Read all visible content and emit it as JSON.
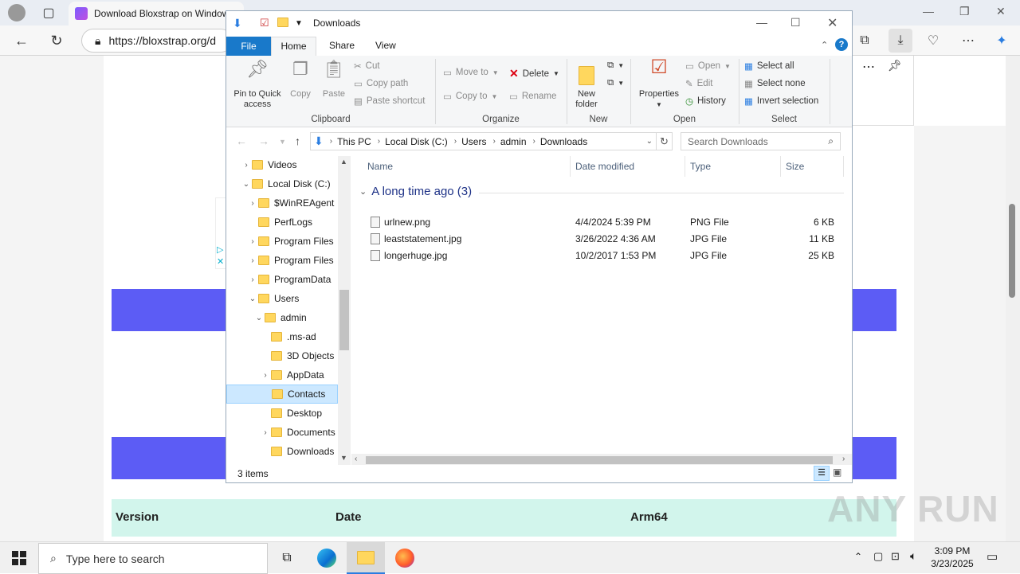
{
  "browser": {
    "tab_title": "Download Bloxstrap on Windows",
    "url": "https://bloxstrap.org/d",
    "back_icon": "arrow-left-icon",
    "reload_icon": "reload-icon"
  },
  "webpage": {
    "version_header": "Version",
    "date_header": "Date",
    "arch_header": "Arm64",
    "ad_play_icon": "▷",
    "ad_close_icon": "✕",
    "accent_color": "#5c5cf5"
  },
  "explorer": {
    "title": "Downloads",
    "ribbon_tabs": [
      "File",
      "Home",
      "Share",
      "View"
    ],
    "clipboard": {
      "pin": "Pin to Quick access",
      "copy": "Copy",
      "paste": "Paste",
      "cut": "Cut",
      "copy_path": "Copy path",
      "paste_shortcut": "Paste shortcut",
      "group": "Clipboard"
    },
    "organize": {
      "move_to": "Move to",
      "copy_to": "Copy to",
      "delete": "Delete",
      "rename": "Rename",
      "group": "Organize"
    },
    "new": {
      "new_folder": "New folder",
      "group": "New"
    },
    "open": {
      "properties": "Properties",
      "open": "Open",
      "edit": "Edit",
      "history": "History",
      "group": "Open"
    },
    "select": {
      "select_all": "Select all",
      "select_none": "Select none",
      "invert": "Invert selection",
      "group": "Select"
    },
    "address": {
      "crumbs": [
        "This PC",
        "Local Disk (C:)",
        "Users",
        "admin",
        "Downloads"
      ]
    },
    "search_placeholder": "Search Downloads",
    "tree": [
      {
        "label": "Videos",
        "indent": 0,
        "exp": "›"
      },
      {
        "label": "Local Disk (C:)",
        "indent": 0,
        "exp": "⌄"
      },
      {
        "label": "$WinREAgent",
        "indent": 1,
        "exp": "›"
      },
      {
        "label": "PerfLogs",
        "indent": 1,
        "exp": ""
      },
      {
        "label": "Program Files",
        "indent": 1,
        "exp": "›"
      },
      {
        "label": "Program Files",
        "indent": 1,
        "exp": "›"
      },
      {
        "label": "ProgramData",
        "indent": 1,
        "exp": "›"
      },
      {
        "label": "Users",
        "indent": 1,
        "exp": "⌄"
      },
      {
        "label": "admin",
        "indent": 2,
        "exp": "⌄"
      },
      {
        "label": ".ms-ad",
        "indent": 3,
        "exp": ""
      },
      {
        "label": "3D Objects",
        "indent": 3,
        "exp": ""
      },
      {
        "label": "AppData",
        "indent": 3,
        "exp": "›"
      },
      {
        "label": "Contacts",
        "indent": 3,
        "exp": ""
      },
      {
        "label": "Desktop",
        "indent": 3,
        "exp": ""
      },
      {
        "label": "Documents",
        "indent": 3,
        "exp": "›"
      },
      {
        "label": "Downloads",
        "indent": 3,
        "exp": ""
      }
    ],
    "columns": [
      "Name",
      "Date modified",
      "Type",
      "Size"
    ],
    "group_header": "A long time ago (3)",
    "files": [
      {
        "name": "urlnew.png",
        "date": "4/4/2024 5:39 PM",
        "type": "PNG File",
        "size": "6 KB"
      },
      {
        "name": "leaststatement.jpg",
        "date": "3/26/2022 4:36 AM",
        "type": "JPG File",
        "size": "11 KB"
      },
      {
        "name": "longerhuge.jpg",
        "date": "10/2/2017 1:53 PM",
        "type": "JPG File",
        "size": "25 KB"
      }
    ],
    "status": "3 items"
  },
  "taskbar": {
    "search_placeholder": "Type here to search",
    "time": "3:09 PM",
    "date": "3/23/2025"
  },
  "watermark": "ANY RUN"
}
